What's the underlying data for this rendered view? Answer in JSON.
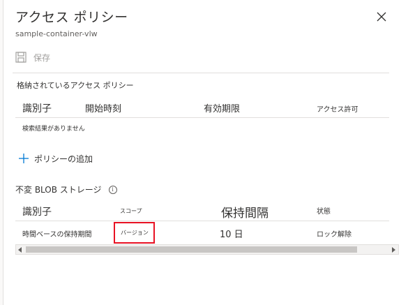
{
  "blade": {
    "title": "アクセス ポリシー",
    "subtitle": "sample-container-vlw"
  },
  "toolbar": {
    "save_label": "保存",
    "save_icon": "save-icon"
  },
  "stored_policies": {
    "section_label": "格納されているアクセス ポリシー",
    "columns": [
      "識別子",
      "開始時刻",
      "有効期限",
      "アクセス許可"
    ],
    "empty_text": "検索結果がありません"
  },
  "add_policy": {
    "label": "ポリシーの追加"
  },
  "immutable": {
    "section_label": "不変 BLOB ストレージ",
    "columns": [
      "識別子",
      "スコープ",
      "保持間隔",
      "状態"
    ],
    "rows": [
      {
        "identifier": "時間ベースの保持期間",
        "scope": "バージョン",
        "interval": "10 日",
        "state": "ロック解除"
      }
    ]
  },
  "colors": {
    "accent": "#0078d4",
    "highlight_border": "#e81123"
  }
}
